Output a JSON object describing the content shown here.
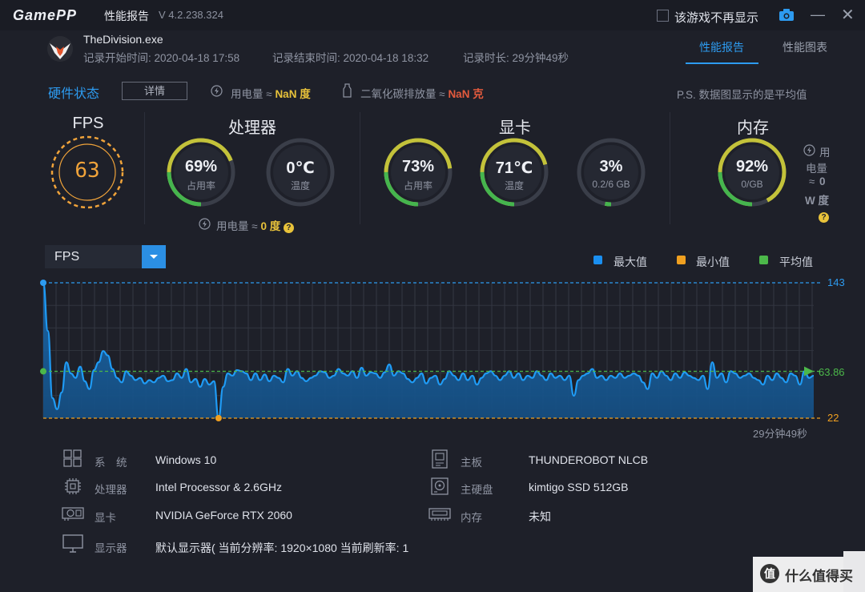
{
  "titlebar": {
    "logo": "GamePP",
    "app_name": "性能报告",
    "version": "V 4.2.238.324",
    "hide_checkbox_label": "该游戏不再显示"
  },
  "header": {
    "exe": "TheDivision.exe",
    "start_time": "记录开始时间: 2020-04-18 17:58",
    "end_time": "记录结束时间: 2020-04-18 18:32",
    "duration": "记录时长: 29分钟49秒",
    "tabs": [
      {
        "label": "性能报告",
        "active": true
      },
      {
        "label": "性能图表",
        "active": false
      }
    ]
  },
  "status": {
    "hw_status": "硬件状态",
    "detail_button": "详情",
    "power_label": "用电量 ≈",
    "power_value": "NaN 度",
    "co2_label": "二氧化碳排放量 ≈",
    "co2_value": "NaN 克",
    "ps_note": "P.S. 数据图显示的是平均值"
  },
  "gauges": {
    "fps": {
      "title": "FPS",
      "value": "63"
    },
    "cpu": {
      "title": "处理器",
      "usage": {
        "value": "69%",
        "label": "占用率",
        "fraction": 0.69
      },
      "temp": {
        "value": "0℃",
        "label": "温度",
        "fraction": 0.0
      },
      "power_label": "用电量 ≈",
      "power_value": "0 度"
    },
    "gpu": {
      "title": "显卡",
      "usage": {
        "value": "73%",
        "label": "占用率",
        "fraction": 0.73
      },
      "temp": {
        "value": "71℃",
        "label": "温度",
        "fraction": 0.71
      },
      "vram": {
        "value": "3%",
        "label": "0.2/6 GB",
        "fraction": 0.03
      }
    },
    "mem": {
      "title": "内存",
      "usage": {
        "value": "92%",
        "label": "0/GB",
        "fraction": 0.92
      },
      "power_line1": "用",
      "power_line2": "电量",
      "power_line3": "≈",
      "power_line4": "0",
      "power_line5": "W 度"
    }
  },
  "chart": {
    "select_label": "FPS",
    "legend": [
      {
        "label": "最大值",
        "color": "#1a8ff0"
      },
      {
        "label": "最小值",
        "color": "#f0a020"
      },
      {
        "label": "平均值",
        "color": "#4cb84a"
      }
    ],
    "max_label": "143",
    "avg_label": "63.86",
    "min_label": "22",
    "duration_label": "29分钟49秒"
  },
  "chart_data": {
    "type": "area",
    "ylim": [
      22,
      143
    ],
    "reference_lines": {
      "max": 143,
      "avg": 63.86,
      "min": 22
    },
    "values": [
      143,
      100,
      40,
      30,
      45,
      72,
      62,
      58,
      68,
      55,
      48,
      65,
      72,
      82,
      78,
      66,
      58,
      54,
      64,
      60,
      56,
      58,
      53,
      56,
      54,
      58,
      60,
      55,
      56,
      62,
      58,
      66,
      54,
      57,
      50,
      57,
      52,
      55,
      22,
      50,
      62,
      60,
      65,
      64,
      62,
      56,
      62,
      56,
      61,
      55,
      60,
      58,
      54,
      66,
      60,
      64,
      58,
      55,
      58,
      60,
      64,
      63,
      58,
      60,
      66,
      62,
      60,
      64,
      58,
      67,
      60,
      63,
      62,
      58,
      63,
      70,
      60,
      64,
      62,
      57,
      54,
      58,
      62,
      53,
      58,
      60,
      52,
      57,
      64,
      60,
      56,
      62,
      56,
      60,
      52,
      58,
      62,
      64,
      60,
      56,
      60,
      64,
      58,
      62,
      56,
      60,
      58,
      64,
      60,
      56,
      62,
      58,
      60,
      56,
      60,
      42,
      56,
      60,
      62,
      66,
      58,
      60,
      56,
      60,
      58,
      62,
      58,
      60,
      62,
      60,
      54,
      48,
      62,
      58,
      64,
      60,
      56,
      62,
      58,
      63,
      60,
      58,
      56,
      60,
      48,
      72,
      58,
      62,
      54,
      64,
      62,
      58,
      60,
      62,
      58,
      56,
      52,
      60,
      56,
      62,
      58,
      54,
      62,
      60,
      52,
      64,
      58,
      60
    ]
  },
  "sysinfo": {
    "left": [
      {
        "label": "系　统",
        "value": "Windows 10"
      },
      {
        "label": "处理器",
        "value": "Intel Processor & 2.6GHz"
      },
      {
        "label": "显卡",
        "value": "NVIDIA GeForce RTX 2060"
      },
      {
        "label": "显示器",
        "value": "默认显示器( 当前分辨率: 1920×1080 当前刷新率: 1"
      }
    ],
    "right": [
      {
        "label": "主板",
        "value": "THUNDEROBOT NLCB"
      },
      {
        "label": "主硬盘",
        "value": "kimtigo SSD 512GB"
      },
      {
        "label": "内存",
        "value": "未知"
      }
    ]
  },
  "watermark": {
    "text": "什么值得买"
  }
}
